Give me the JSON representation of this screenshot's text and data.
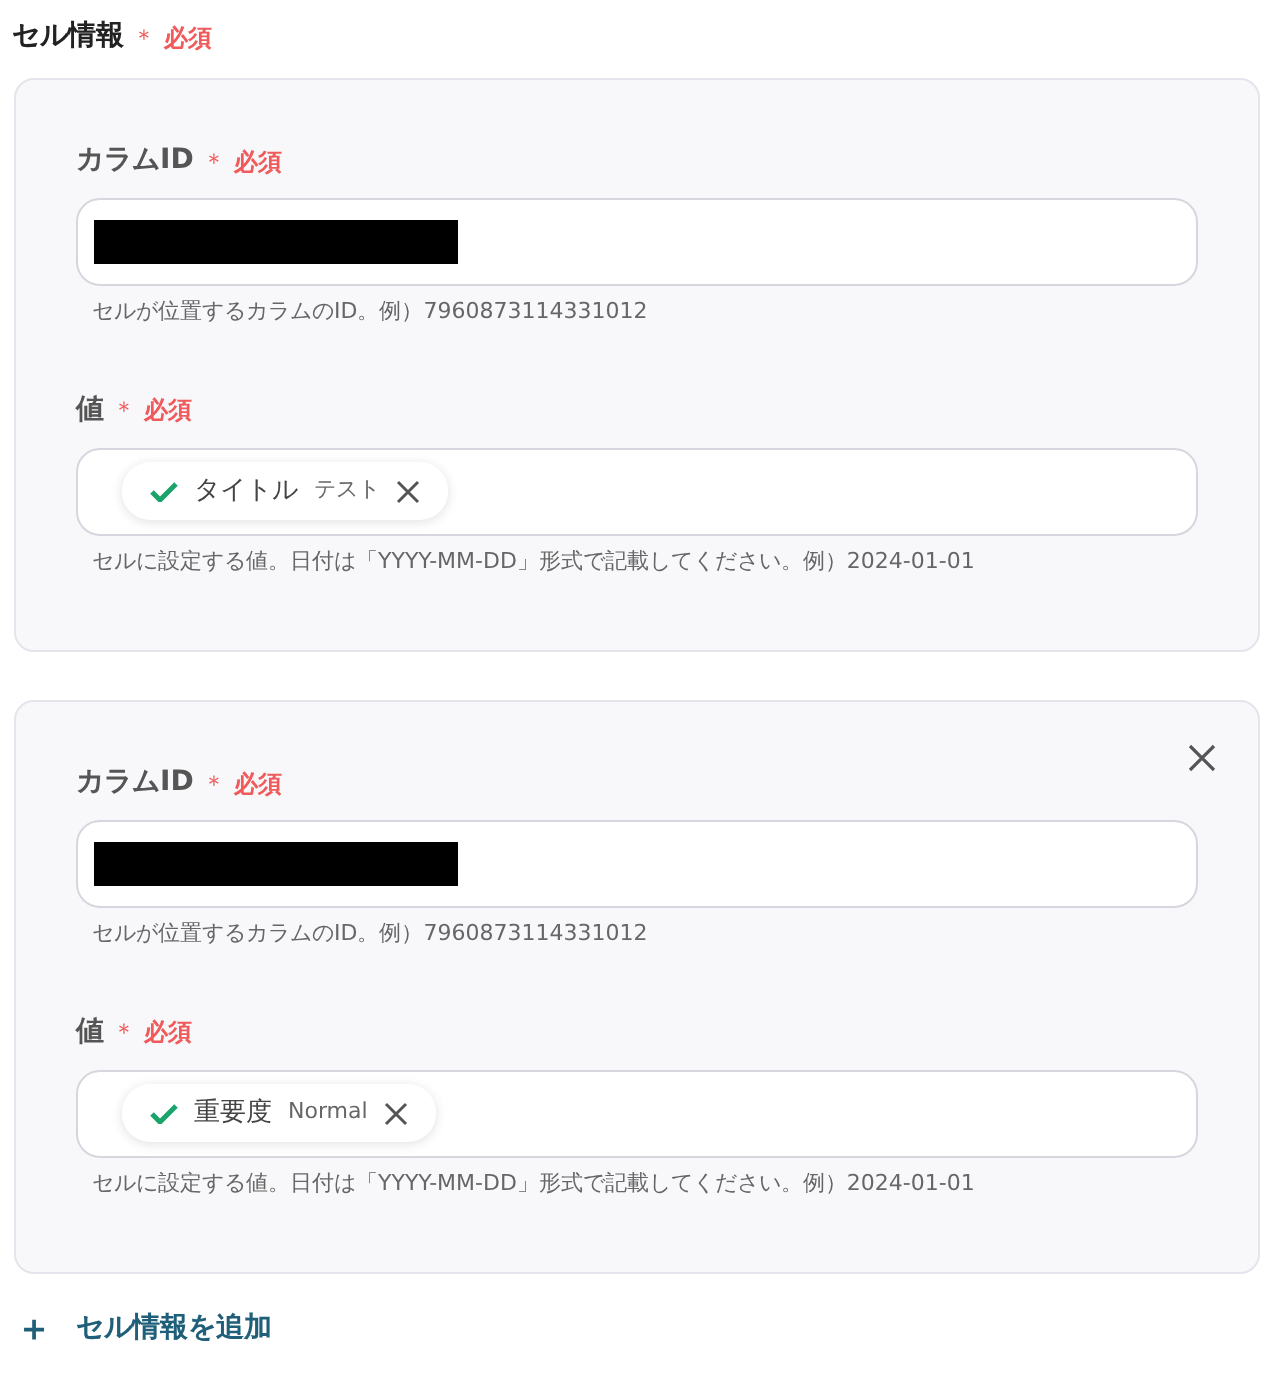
{
  "section": {
    "title": "セル情報",
    "required_mark": "＊",
    "required_label": "必須"
  },
  "cells": [
    {
      "removable": false,
      "column_id": {
        "label": "カラムID",
        "required_mark": "＊",
        "required_label": "必須",
        "redacted": true,
        "help": "セルが位置するカラムのID。例）7960873114331012"
      },
      "value": {
        "label": "値",
        "required_mark": "＊",
        "required_label": "必須",
        "chip": {
          "name": "タイトル",
          "sample": "テスト"
        },
        "help": "セルに設定する値。日付は「YYYY-MM-DD」形式で記載してください。例）2024-01-01"
      }
    },
    {
      "removable": true,
      "column_id": {
        "label": "カラムID",
        "required_mark": "＊",
        "required_label": "必須",
        "redacted": true,
        "help": "セルが位置するカラムのID。例）7960873114331012"
      },
      "value": {
        "label": "値",
        "required_mark": "＊",
        "required_label": "必須",
        "chip": {
          "name": "重要度",
          "sample": "Normal"
        },
        "help": "セルに設定する値。日付は「YYYY-MM-DD」形式で記載してください。例）2024-01-01"
      }
    }
  ],
  "add_button": {
    "icon": "＋",
    "label": "セル情報を追加"
  }
}
